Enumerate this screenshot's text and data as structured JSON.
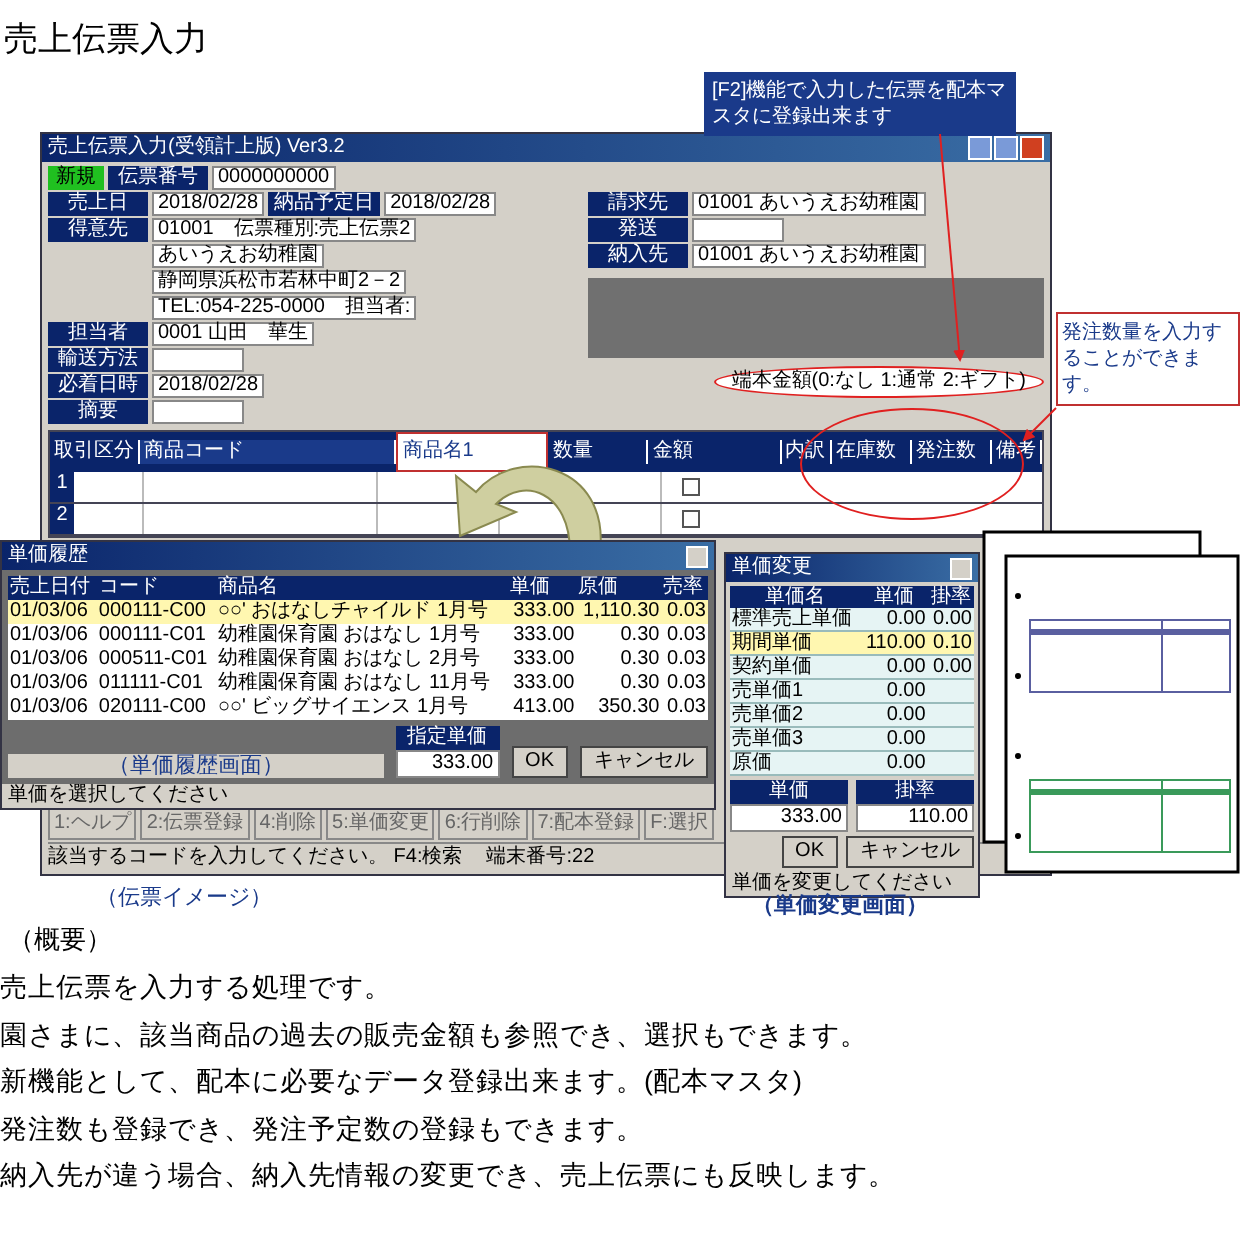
{
  "page_title": "売上伝票入力",
  "main_window": {
    "title": "売上伝票入力(受領計上版) Ver3.2",
    "mode": "新規",
    "slip_label": "伝票番号",
    "slip_no": "0000000000",
    "left_fields": [
      {
        "label": "売上日",
        "value": "2018/02/28"
      },
      {
        "label": "得意先",
        "value": "01001　伝票種別:売上伝票2"
      },
      {
        "value": "あいうえお幼稚園"
      },
      {
        "value": "静岡県浜松市若林中町2－2"
      },
      {
        "value": "TEL:054-225-0000　担当者:"
      },
      {
        "label": "担当者",
        "value": "0001 山田　華生"
      },
      {
        "label": "輸送方法"
      },
      {
        "label": "必着日時",
        "value": "2018/02/28"
      },
      {
        "label": "摘要"
      }
    ],
    "due_label": "納品予定日",
    "due_value": "2018/02/28",
    "right_fields": [
      {
        "label": "請求先",
        "value": "01001 あいうえお幼稚園"
      },
      {
        "label": "発送"
      },
      {
        "label": "納入先",
        "value": "01001 あいうえお幼稚園"
      }
    ],
    "price_note": "端本金額(0:なし 1:通常 2:ギフト)",
    "columns": [
      "取引区分",
      "商品コード",
      "商品名1",
      "数量",
      "金額",
      "内訳",
      "在庫数",
      "発注数",
      "備考"
    ],
    "rows": [
      {
        "no": "1",
        "checked": false
      },
      {
        "no": "2",
        "checked": false
      }
    ],
    "function_keys": [
      "1:ヘルプ",
      "2:伝票登録",
      "4:削除",
      "5:単価変更",
      "6:行削除",
      "7:配本登録",
      "F:選択"
    ],
    "status": "該当するコードを入力してください。 F4:検索",
    "terminal": "端末番号:22"
  },
  "callouts": [
    {
      "text": "[F2]機能で入力した伝票を配本マスタに登録出来ます"
    },
    {
      "text": "発注数量を入力することができます。"
    }
  ],
  "history_dialog": {
    "title": "単価履歴",
    "columns": [
      "売上日付",
      "コード",
      "商品名",
      "単価",
      "原価",
      "売率"
    ],
    "rows": [
      {
        "cells": [
          "01/03/06",
          "000111-C00",
          "○○' おはなしチャイルド 1月号",
          "333.00",
          "1,110.30",
          "0.03"
        ],
        "selected": true
      },
      {
        "cells": [
          "01/03/06",
          "000111-C01",
          "幼稚園保育園 おはなし 1月号",
          "333.00",
          "0.30",
          "0.03"
        ],
        "selected": false
      },
      {
        "cells": [
          "01/03/06",
          "000511-C01",
          "幼稚園保育園 おはなし 2月号",
          "333.00",
          "0.30",
          "0.03"
        ],
        "selected": false
      },
      {
        "cells": [
          "01/03/06",
          "011111-C01",
          "幼稚園保育園 おはなし 11月号",
          "333.00",
          "0.30",
          "0.03"
        ],
        "selected": false
      },
      {
        "cells": [
          "01/03/06",
          "020111-C00",
          "○○' ビッグサイエンス 1月号",
          "413.00",
          "350.30",
          "0.03"
        ],
        "selected": false
      }
    ],
    "caption": "（単価履歴画面）",
    "price_label": "指定単価",
    "price_value": "333.00",
    "buttons": [
      "OK",
      "キャンセル"
    ],
    "status": "単価を選択してください"
  },
  "price_dialog": {
    "title": "単価変更",
    "columns": [
      "単価名",
      "単価",
      "掛率"
    ],
    "rows": [
      {
        "cells": [
          "標準売上単価",
          "0.00",
          "0.00"
        ],
        "selected": false
      },
      {
        "cells": [
          "期間単価",
          "110.00",
          "0.10"
        ],
        "selected": true
      },
      {
        "cells": [
          "契約単価",
          "0.00",
          "0.00"
        ],
        "selected": false
      },
      {
        "cells": [
          "売単価1",
          "0.00",
          ""
        ],
        "selected": false
      },
      {
        "cells": [
          "売単価2",
          "0.00",
          ""
        ],
        "selected": false
      },
      {
        "cells": [
          "売単価3",
          "0.00",
          ""
        ],
        "selected": false
      },
      {
        "cells": [
          "原価",
          "0.00",
          ""
        ],
        "selected": false
      }
    ],
    "unit_label": "単価",
    "unit_value": "333.00",
    "rate_label": "掛率",
    "rate_value": "110.00",
    "buttons": [
      "OK",
      "キャンセル"
    ],
    "status": "単価を変更してください"
  },
  "captions": [
    "（伝票イメージ）",
    "（単価変更画面）"
  ],
  "overview": {
    "heading": "（概要）",
    "lines": [
      "売上伝票を入力する処理です。",
      "園さまに、該当商品の過去の販売金額も参照でき、選択もできます。",
      "新機能として、配本に必要なデータ登録出来ます。(配本マスタ)",
      "発注数も登録でき、発注予定数の登録もできます。",
      "納入先が違う場合、納入先情報の変更でき、売上伝票にも反映します。"
    ]
  }
}
